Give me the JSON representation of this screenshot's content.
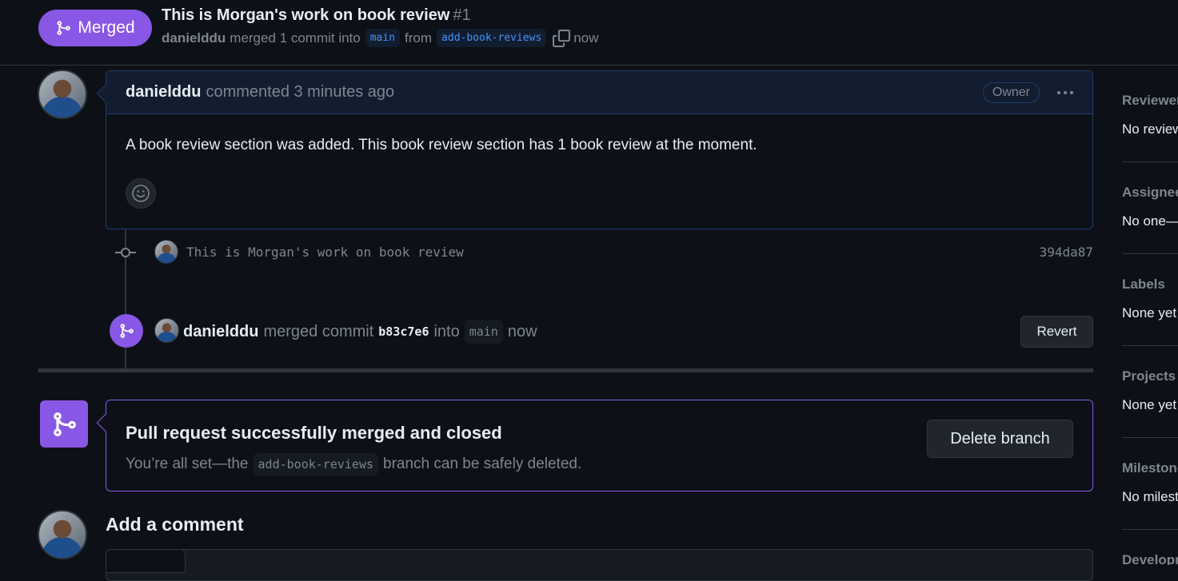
{
  "header": {
    "state": "Merged",
    "title": "This is Morgan's work on book review",
    "number": "#1",
    "author": "danielddu",
    "merged_text": "merged 1 commit into",
    "base_branch": "main",
    "from_text": "from",
    "head_branch": "add-book-reviews",
    "time": "now"
  },
  "comment": {
    "author": "danielddu",
    "action": "commented 3 minutes ago",
    "role": "Owner",
    "body": "A book review section was added. This book review section has 1 book review at the moment."
  },
  "commit": {
    "message": "This is Morgan's work on book review",
    "sha": "394da87"
  },
  "merge_event": {
    "author": "danielddu",
    "action": "merged commit",
    "sha": "b83c7e6",
    "into_text": "into",
    "branch": "main",
    "time": "now",
    "revert_label": "Revert"
  },
  "merged_box": {
    "title": "Pull request successfully merged and closed",
    "sub_before": "You’re all set—the",
    "branch": "add-book-reviews",
    "sub_after": "branch can be safely deleted.",
    "delete_label": "Delete branch"
  },
  "add_comment": {
    "title": "Add a comment"
  },
  "sidebar": {
    "sections": [
      {
        "heading": "Reviewers",
        "value": "No reviewers"
      },
      {
        "heading": "Assignees",
        "value": "No one—"
      },
      {
        "heading": "Labels",
        "value": "None yet"
      },
      {
        "heading": "Projects",
        "value": "None yet"
      },
      {
        "heading": "Milestone",
        "value": "No milestone"
      },
      {
        "heading": "Development",
        "value": ""
      }
    ]
  },
  "colors": {
    "background": "#0d1117",
    "merged_purple": "#8957e5",
    "link_blue": "#4493f8",
    "muted_text": "#7d8590"
  }
}
